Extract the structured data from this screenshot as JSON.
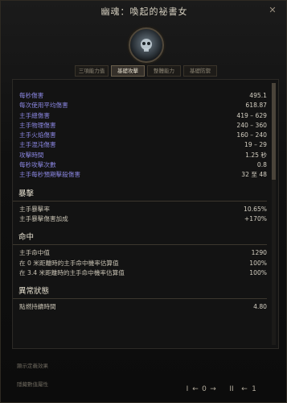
{
  "window": {
    "title": "幽魂：喚起的祕書女",
    "close_glyph": "✕"
  },
  "emblem_icon": "skull-emblem-icon",
  "tabs": [
    {
      "label": "三項能力值",
      "active": false
    },
    {
      "label": "基礎攻擊",
      "active": true
    },
    {
      "label": "整體能力",
      "active": false
    },
    {
      "label": "基礎防禦",
      "active": false
    }
  ],
  "stats": [
    {
      "label": "每秒傷害",
      "value": "495.1"
    },
    {
      "label": "每次使用平均傷害",
      "value": "618.87"
    },
    {
      "label": "主手總傷害",
      "value": "419 – 629"
    },
    {
      "label": "主手物理傷害",
      "value": "240 – 360"
    },
    {
      "label": "主手火焰傷害",
      "value": "160 – 240"
    },
    {
      "label": "主手混沌傷害",
      "value": "19 – 29"
    },
    {
      "label": "攻擊時間",
      "value": "1.25 秒"
    },
    {
      "label": "每秒攻擊次數",
      "value": "0.8"
    },
    {
      "label": "主手每秒預期擊殺傷害",
      "value": "32 至 48"
    }
  ],
  "sections": [
    {
      "title": "暴擊",
      "rows": [
        {
          "label": "主手暴擊率",
          "value": "10.65%"
        },
        {
          "label": "主手暴擊傷害加成",
          "value": "+170%"
        }
      ]
    },
    {
      "title": "命中",
      "rows": [
        {
          "label": "主手命中值",
          "value": "1290"
        },
        {
          "label": "在 0 米距離時的主手命中機率估算值",
          "value": "100%"
        },
        {
          "label": "在 3.4 米距離時的主手命中機率估算值",
          "value": "100%"
        }
      ]
    },
    {
      "title": "異常狀態",
      "rows": [
        {
          "label": "點燃持續時間",
          "value": "4.80"
        }
      ]
    }
  ],
  "footer": {
    "line1": "顯示定義效果",
    "line2": "隱藏數值屬性"
  },
  "nav": {
    "left_first": "I",
    "left_arrow": "←",
    "left_value": "0",
    "left_next": "→",
    "mid": "II",
    "right_arrow": "←",
    "right_value": "1"
  }
}
